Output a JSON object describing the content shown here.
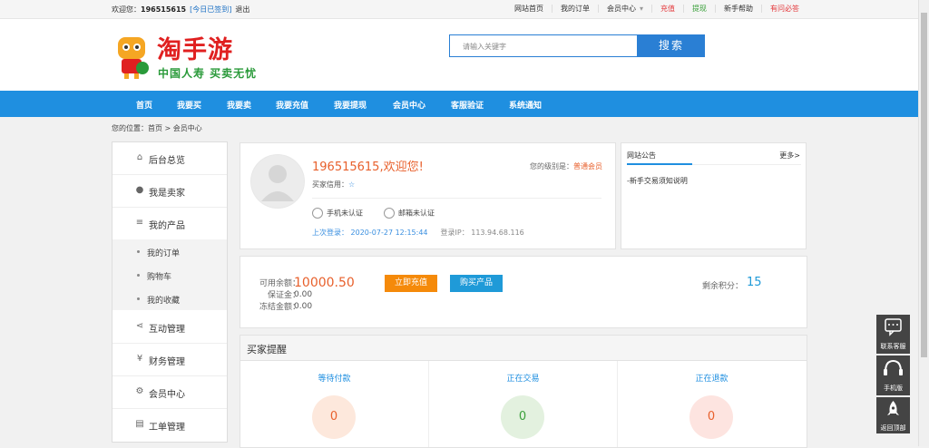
{
  "topbar": {
    "welcome_prefix": "欢迎您：",
    "username": "196515615",
    "signed": "[今日已签到]",
    "logout": "退出",
    "links": [
      "网站首页",
      "我的订单",
      "会员中心",
      "充值",
      "提现",
      "新手帮助",
      "有问必答"
    ]
  },
  "logo": {
    "name": "淘手游",
    "tagline": "中国人寿 买卖无忧"
  },
  "search": {
    "placeholder": "请输入关键字",
    "button": "搜索"
  },
  "nav": [
    "首页",
    "我要买",
    "我要卖",
    "我要充值",
    "我要提现",
    "会员中心",
    "客服验证",
    "系统通知"
  ],
  "breadcrumb": "您的位置：首页 > 会员中心",
  "sidebar": {
    "items": [
      {
        "label": "后台总览",
        "icon": "home-icon"
      },
      {
        "label": "我是卖家",
        "icon": "user-icon"
      },
      {
        "label": "我的产品",
        "icon": "list-icon"
      },
      {
        "label": "互动管理",
        "icon": "share-icon"
      },
      {
        "label": "财务管理",
        "icon": "yen-icon"
      },
      {
        "label": "会员中心",
        "icon": "cog-icon"
      },
      {
        "label": "工单管理",
        "icon": "clipboard-icon"
      }
    ],
    "subitems": [
      "我的订单",
      "购物车",
      "我的收藏"
    ]
  },
  "profile": {
    "welcome": "196515615,欢迎您!",
    "level_label": "您的级别是：",
    "level": "普通会员",
    "credit_label": "买家信用：",
    "phone_auth": "手机未认证",
    "email_auth": "邮箱未认证",
    "last_login": "上次登录： 2020-07-27 12:15:44",
    "login_ip": "登录IP： 113.94.68.116"
  },
  "notice": {
    "title": "网站公告",
    "more": "更多>",
    "items": [
      "-新手交易须知说明"
    ]
  },
  "balance": {
    "available_label": "可用余额：",
    "available": "10000.50",
    "deposit_label": "保证金：",
    "deposit": "0.00",
    "frozen_label": "冻结金额：",
    "frozen": "0.00",
    "recharge_button": "立即充值",
    "buy_button": "购买产品",
    "points_label": "剩余积分：",
    "points": "15"
  },
  "remind": {
    "title": "买家提醒",
    "columns": [
      {
        "label": "等待付款",
        "count": "0",
        "bg": "#fde8dc",
        "color": "#e8602c"
      },
      {
        "label": "正在交易",
        "count": "0",
        "bg": "#e3f1df",
        "color": "#3aa03a"
      },
      {
        "label": "正在退款",
        "count": "0",
        "bg": "#fde4e0",
        "color": "#e8602c"
      }
    ]
  },
  "float": {
    "service": "联系客服",
    "mobile": "手机版",
    "top": "返回顶部"
  },
  "colors": {
    "primary": "#1f8fe0",
    "accent": "#e8602c",
    "orange": "#f58a0a"
  }
}
